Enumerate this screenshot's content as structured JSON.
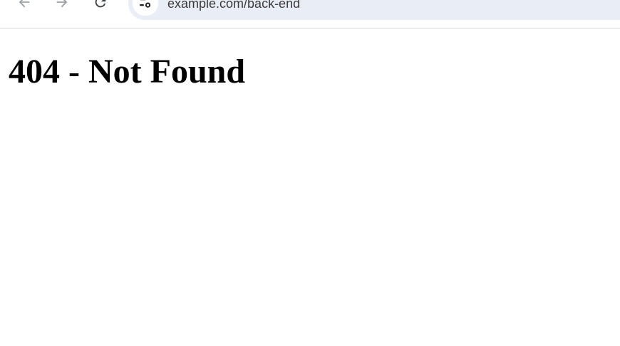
{
  "browser": {
    "toolbar": {
      "buttons": {
        "back_icon": "arrow-left-icon",
        "forward_icon": "arrow-right-icon",
        "reload_icon": "reload-icon"
      },
      "address_bar": {
        "site_info_icon": "tune-icon",
        "url": "example.com/back-end"
      }
    }
  },
  "page": {
    "heading": "404 - Not Found"
  },
  "colors": {
    "address_bar_bg": "#e9edf6",
    "icon_disabled": "#9aa0a6",
    "icon_active": "#3c4043",
    "heading_text": "#000000"
  }
}
